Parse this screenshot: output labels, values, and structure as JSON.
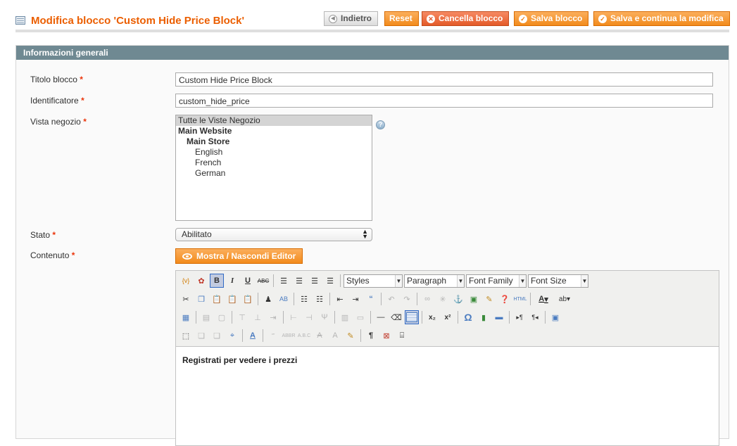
{
  "header": {
    "title": "Modifica blocco 'Custom Hide Price Block'",
    "buttons": {
      "back": "Indietro",
      "reset": "Reset",
      "delete": "Cancella blocco",
      "save": "Salva blocco",
      "save_continue": "Salva e continua la modifica"
    }
  },
  "fieldset": {
    "legend": "Informazioni generali",
    "title_label": "Titolo blocco",
    "title_value": "Custom Hide Price Block",
    "identifier_label": "Identificatore",
    "identifier_value": "custom_hide_price",
    "store_label": "Vista negozio",
    "store_options": [
      {
        "label": "Tutte le Viste Negozio",
        "selected": true
      },
      {
        "label": "Main Website"
      },
      {
        "label": "Main Store"
      },
      {
        "label": "English"
      },
      {
        "label": "French"
      },
      {
        "label": "German"
      }
    ],
    "status_label": "Stato",
    "status_value": "Abilitato",
    "content_label": "Contenuto",
    "toggle_editor": "Mostra / Nascondi Editor",
    "required_mark": "*"
  },
  "editor": {
    "styles": "Styles",
    "format": "Paragraph",
    "font_family": "Font Family",
    "font_size": "Font Size",
    "content": "Registrati per vedere i prezzi",
    "bold_glyph": "B",
    "italic_glyph": "I",
    "underline_glyph": "U",
    "strike_glyph": "ABC",
    "font_color_glyph": "A",
    "highlight_glyph": "ab",
    "omega_glyph": "Ω",
    "pilcrow_glyph": "¶",
    "html_glyph": "HTML",
    "sub_glyph": "x₂",
    "sup_glyph": "x²",
    "variable_glyph": "{v}",
    "find_glyph": "AB"
  },
  "colors": {
    "accent": "#eb5e00",
    "header_bar": "#6f8992",
    "button_orange": "#f28b1c"
  }
}
